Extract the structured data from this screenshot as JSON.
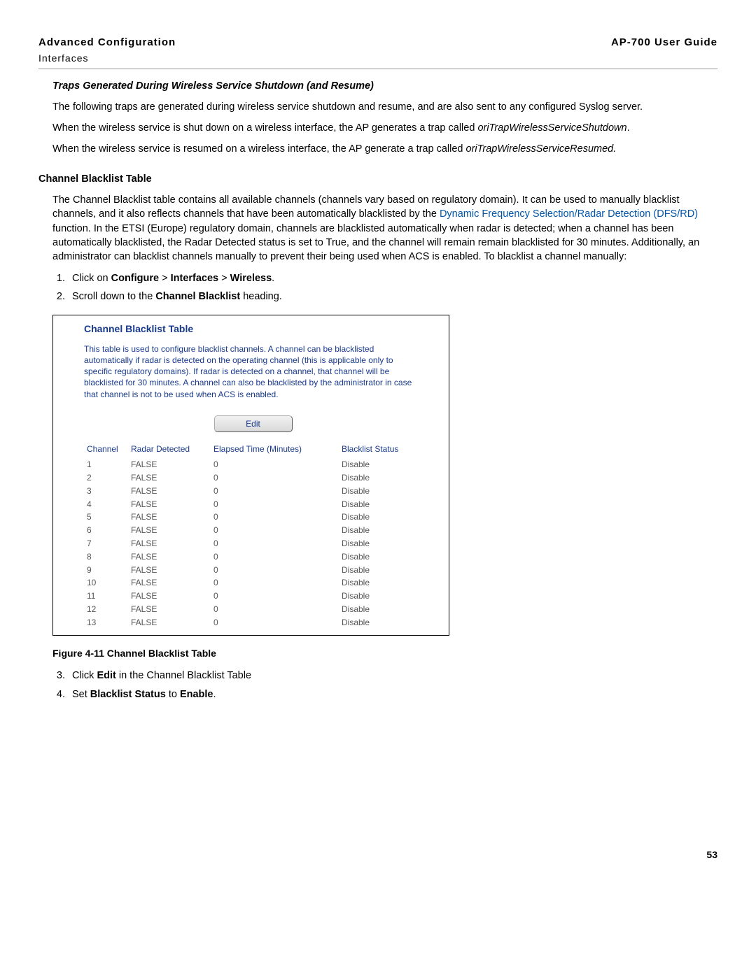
{
  "header": {
    "left_title": "Advanced Configuration",
    "left_sub": "Interfaces",
    "right": "AP-700 User Guide"
  },
  "traps": {
    "heading": "Traps Generated During Wireless Service Shutdown (and Resume)",
    "p1": "The following traps are generated during wireless service shutdown and resume, and are also sent to any configured Syslog server.",
    "p2a": "When the wireless service is shut down on a wireless interface, the AP generates a trap called ",
    "p2b": "oriTrapWirelessServiceShutdown",
    "p3a": "When the wireless service is resumed on a wireless interface, the AP generate a trap called ",
    "p3b": "oriTrapWirelessServiceResumed."
  },
  "blacklist": {
    "heading": "Channel Blacklist Table",
    "para_a": "The Channel Blacklist table contains all available channels (channels vary based on regulatory domain). It can be used to manually blacklist channels, and it also reflects channels that have been automatically blacklisted by the ",
    "link": "Dynamic Frequency Selection/Radar Detection (DFS/RD)",
    "para_b": " function. In the ETSI (Europe) regulatory domain, channels are blacklisted automatically when radar is detected; when a channel has been automatically blacklisted, the Radar Detected status is set to True, and the channel will remain remain blacklisted for 30 minutes. Additionally, an administrator can blacklist channels manually to prevent their being used when ACS is enabled. To blacklist a channel manually:",
    "step1_a": "Click on ",
    "step1_b": "Configure",
    "step1_c": " > ",
    "step1_d": "Interfaces",
    "step1_e": " > ",
    "step1_f": "Wireless",
    "step1_g": ".",
    "step2_a": "Scroll down to the ",
    "step2_b": "Channel Blacklist",
    "step2_c": " heading."
  },
  "panel": {
    "title": "Channel Blacklist Table",
    "desc": "This table is used to configure blacklist channels. A channel can be blacklisted automatically if radar is detected on the operating channel (this is applicable only to specific regulatory domains). If radar is detected on a channel, that channel will be blacklisted for 30 minutes. A channel can also be blacklisted by the administrator in case that channel is not to be used when ACS is enabled.",
    "edit_label": "Edit",
    "headers": {
      "channel": "Channel",
      "radar": "Radar Detected",
      "elapsed": "Elapsed Time (Minutes)",
      "status": "Blacklist Status"
    },
    "rows": [
      {
        "channel": "1",
        "radar": "FALSE",
        "elapsed": "0",
        "status": "Disable"
      },
      {
        "channel": "2",
        "radar": "FALSE",
        "elapsed": "0",
        "status": "Disable"
      },
      {
        "channel": "3",
        "radar": "FALSE",
        "elapsed": "0",
        "status": "Disable"
      },
      {
        "channel": "4",
        "radar": "FALSE",
        "elapsed": "0",
        "status": "Disable"
      },
      {
        "channel": "5",
        "radar": "FALSE",
        "elapsed": "0",
        "status": "Disable"
      },
      {
        "channel": "6",
        "radar": "FALSE",
        "elapsed": "0",
        "status": "Disable"
      },
      {
        "channel": "7",
        "radar": "FALSE",
        "elapsed": "0",
        "status": "Disable"
      },
      {
        "channel": "8",
        "radar": "FALSE",
        "elapsed": "0",
        "status": "Disable"
      },
      {
        "channel": "9",
        "radar": "FALSE",
        "elapsed": "0",
        "status": "Disable"
      },
      {
        "channel": "10",
        "radar": "FALSE",
        "elapsed": "0",
        "status": "Disable"
      },
      {
        "channel": "11",
        "radar": "FALSE",
        "elapsed": "0",
        "status": "Disable"
      },
      {
        "channel": "12",
        "radar": "FALSE",
        "elapsed": "0",
        "status": "Disable"
      },
      {
        "channel": "13",
        "radar": "FALSE",
        "elapsed": "0",
        "status": "Disable"
      }
    ]
  },
  "figure_caption": "Figure 4-11 Channel Blacklist Table",
  "steps2": {
    "s3_a": "Click ",
    "s3_b": "Edit",
    "s3_c": " in the Channel Blacklist Table",
    "s4_a": "Set ",
    "s4_b": "Blacklist Status",
    "s4_c": " to ",
    "s4_d": "Enable",
    "s4_e": "."
  },
  "page_number": "53"
}
